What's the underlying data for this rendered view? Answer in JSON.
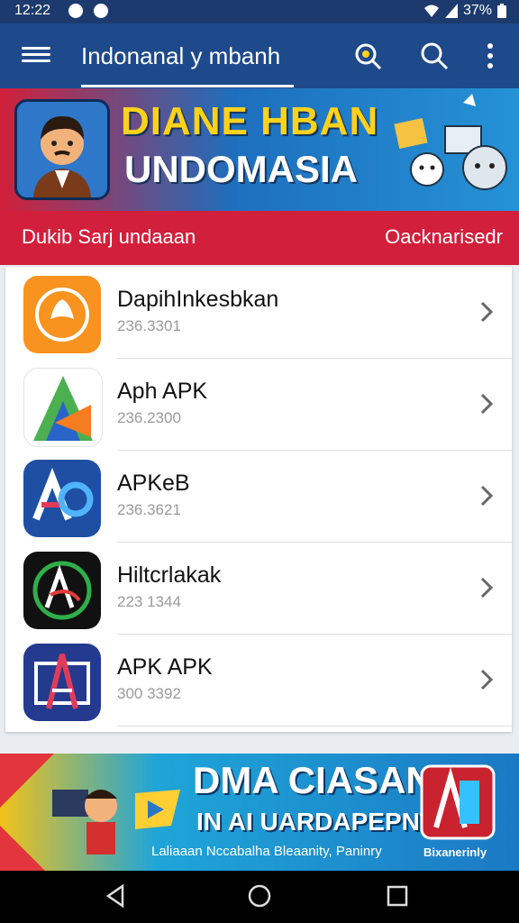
{
  "status_bar": {
    "time": "12:22",
    "battery": "37%"
  },
  "app_bar": {
    "title": "Indonanal y mbanh"
  },
  "banner": {
    "line1": "DIANE HBAN",
    "line2": "UNDOMASIA"
  },
  "section": {
    "left_label": "Dukib Sarj undaaan",
    "right_label": "Oacknarisedr"
  },
  "list": {
    "items": [
      {
        "name": "DapihInkesbkan",
        "subtitle": "236.3301",
        "icon": "leaf-app-icon",
        "color": "#f7931e"
      },
      {
        "name": "Aph APK",
        "subtitle": "236.2300",
        "icon": "a-triangle-app-icon",
        "color": "#4caf50"
      },
      {
        "name": "APKeB",
        "subtitle": "236.3621",
        "icon": "ap-app-icon",
        "color": "#1e4fa3"
      },
      {
        "name": "Hiltcrlakak",
        "subtitle": "223 1344",
        "icon": "circle-a-app-icon",
        "color": "#111111"
      },
      {
        "name": "APK APK",
        "subtitle": "300 3392",
        "icon": "boxed-a-app-icon",
        "color": "#233a8f"
      }
    ]
  },
  "bottom_banner": {
    "line1": "DMA CIASAN",
    "line2": "IN AI UARDAPEPNTS",
    "line3": "Laliaaan Nccabalha Bleaanity, Paninry",
    "brand": "Bixanerinly"
  }
}
